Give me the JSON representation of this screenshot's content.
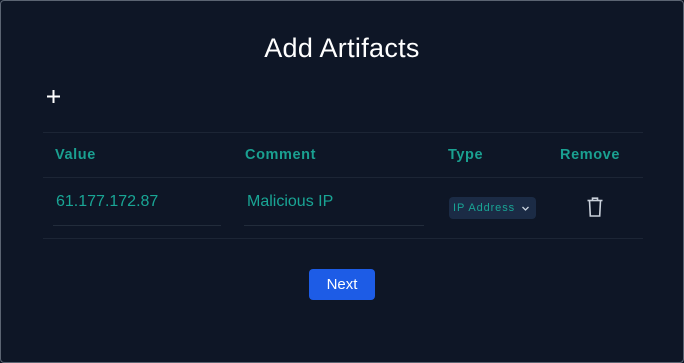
{
  "title": "Add Artifacts",
  "icons": {
    "add": "plus-icon",
    "remove": "trash-icon",
    "dropdown": "chevron-down-icon"
  },
  "table": {
    "headers": {
      "value": "Value",
      "comment": "Comment",
      "type": "Type",
      "remove": "Remove"
    },
    "rows": [
      {
        "value": "61.177.172.87",
        "comment": "Malicious IP",
        "type": "IP Address"
      }
    ]
  },
  "next_label": "Next",
  "colors": {
    "background": "#0e1626",
    "accent": "#1aa091",
    "button": "#1d5ce6",
    "select_bg": "#1b2b45"
  }
}
